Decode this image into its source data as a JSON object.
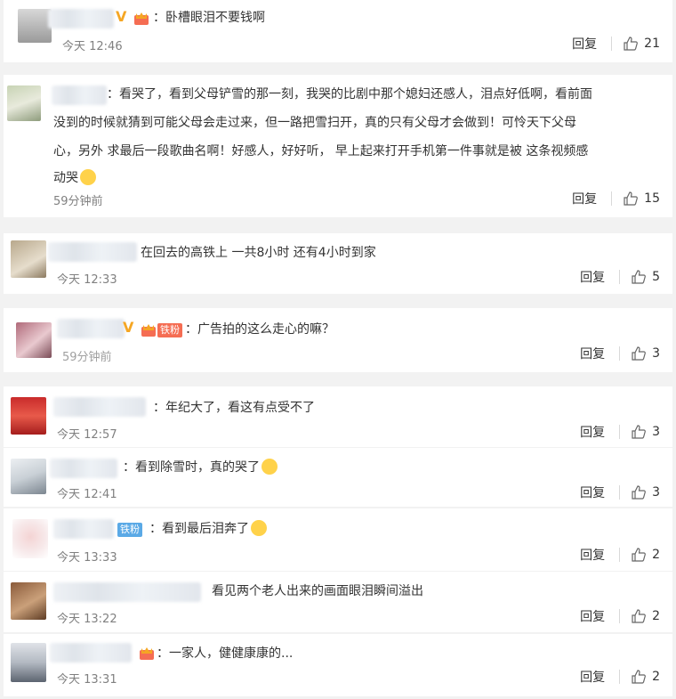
{
  "actions": {
    "reply_label": "回复"
  },
  "comments": [
    {
      "text": "：卧槽眼泪不要钱啊",
      "time": "今天 12:46",
      "likes": "21"
    },
    {
      "lines": [
        "：看哭了，看到父母铲雪的那一刻，我哭的比剧中那个媳妇还感人，泪点好低啊，看前面",
        "没到的时候就猜到可能父母会走过来，但一路把雪扫开，真的只有父母才会做到！可怜天下父母",
        "心，另外 求最后一段歌曲名啊！好感人，好好听， 早上起来打开手机第一件事就是被 这条视频感",
        "动哭"
      ],
      "time": "59分钟前",
      "likes": "15"
    },
    {
      "text": "在回去的高铁上 一共8小时 还有4小时到家",
      "time": "今天 12:33",
      "likes": "5"
    },
    {
      "text": "：广告拍的这么走心的嘛？",
      "badge": "铁粉",
      "time": "59分钟前",
      "likes": "3"
    },
    {
      "text": "：年纪大了，看这有点受不了",
      "time": "今天 12:57",
      "likes": "3"
    },
    {
      "text": "：看到除雪时，真的哭了",
      "time": "今天 12:41",
      "likes": "3"
    },
    {
      "text": "：看到最后泪奔了",
      "badge": "铁粉",
      "time": "今天 13:33",
      "likes": "2"
    },
    {
      "text": "看见两个老人出来的画面眼泪瞬间溢出",
      "time": "今天 13:22",
      "likes": "2"
    },
    {
      "text": "：一家人，健健康康的...",
      "time": "今天 13:31",
      "likes": "2"
    }
  ],
  "colors": {
    "accent_vip": "#f5a623",
    "fan_badge_red": "#f56d53",
    "fan_badge_blue": "#5aa9e6"
  }
}
